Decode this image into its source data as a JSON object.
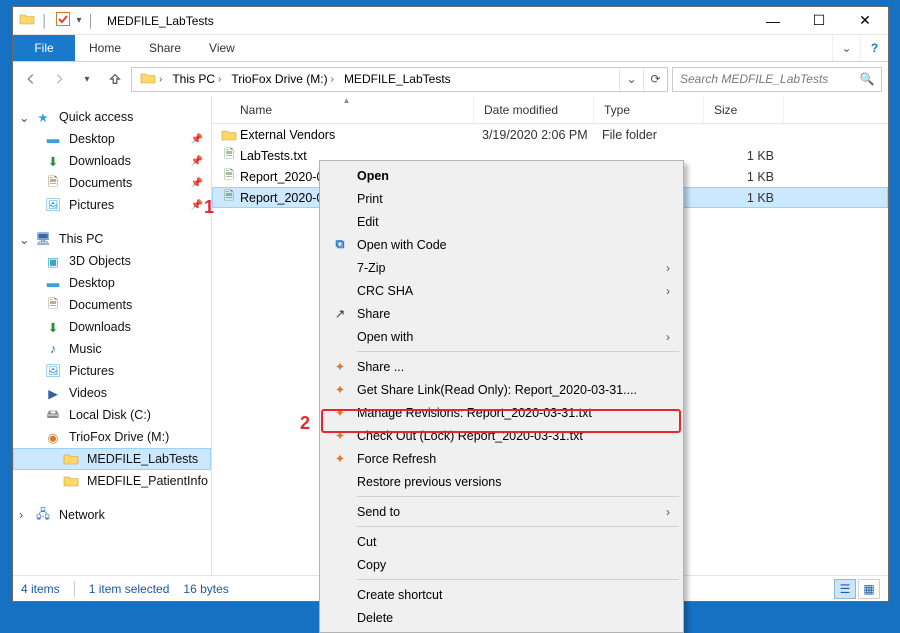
{
  "window": {
    "title": "MEDFILE_LabTests"
  },
  "ribbon": {
    "file": "File",
    "tabs": [
      "Home",
      "Share",
      "View"
    ]
  },
  "breadcrumb": {
    "root": "This PC",
    "drive": "TrioFox Drive (M:)",
    "folder": "MEDFILE_LabTests"
  },
  "search": {
    "placeholder": "Search MEDFILE_LabTests"
  },
  "nav": {
    "quick_access": "Quick access",
    "qa_items": [
      {
        "label": "Desktop",
        "icon": "desktop"
      },
      {
        "label": "Downloads",
        "icon": "downloads"
      },
      {
        "label": "Documents",
        "icon": "documents"
      },
      {
        "label": "Pictures",
        "icon": "pictures"
      }
    ],
    "this_pc": "This PC",
    "pc_items": [
      {
        "label": "3D Objects",
        "icon": "3d"
      },
      {
        "label": "Desktop",
        "icon": "desktop"
      },
      {
        "label": "Documents",
        "icon": "documents"
      },
      {
        "label": "Downloads",
        "icon": "downloads"
      },
      {
        "label": "Music",
        "icon": "music"
      },
      {
        "label": "Pictures",
        "icon": "pictures"
      },
      {
        "label": "Videos",
        "icon": "videos"
      },
      {
        "label": "Local Disk (C:)",
        "icon": "disk"
      },
      {
        "label": "TrioFox Drive (M:)",
        "icon": "netdrive"
      }
    ],
    "subfolders": [
      {
        "label": "MEDFILE_LabTests"
      },
      {
        "label": "MEDFILE_PatientInfo"
      }
    ],
    "network": "Network"
  },
  "columns": {
    "name": "Name",
    "date": "Date modified",
    "type": "Type",
    "size": "Size"
  },
  "files": [
    {
      "name": "External Vendors",
      "date": "3/19/2020 2:06 PM",
      "type": "File folder",
      "size": "",
      "icon": "folder"
    },
    {
      "name": "LabTests.txt",
      "date": "",
      "type": "",
      "size": "1 KB",
      "icon": "txt"
    },
    {
      "name": "Report_2020-0",
      "date": "",
      "type": "",
      "size": "1 KB",
      "icon": "txt"
    },
    {
      "name": "Report_2020-0",
      "date": "",
      "type": "",
      "size": "1 KB",
      "icon": "txt",
      "selected": true
    }
  ],
  "context_menu": {
    "open": "Open",
    "print": "Print",
    "edit": "Edit",
    "open_code": "Open with Code",
    "sevenzip": "7-Zip",
    "crcsha": "CRC SHA",
    "share": "Share",
    "open_with": "Open with",
    "tf_share": "Share ...",
    "tf_link": "Get Share Link(Read Only): Report_2020-03-31....",
    "tf_revisions": "Manage Revisions: Report_2020-03-31.txt",
    "tf_checkout": "Check Out (Lock) Report_2020-03-31.txt",
    "tf_refresh": "Force Refresh",
    "restore": "Restore previous versions",
    "send_to": "Send to",
    "cut": "Cut",
    "copy": "Copy",
    "shortcut": "Create shortcut",
    "delete": "Delete"
  },
  "status": {
    "count": "4 items",
    "sel": "1 item selected",
    "bytes": "16 bytes"
  },
  "callouts": {
    "one": "1",
    "two": "2"
  }
}
